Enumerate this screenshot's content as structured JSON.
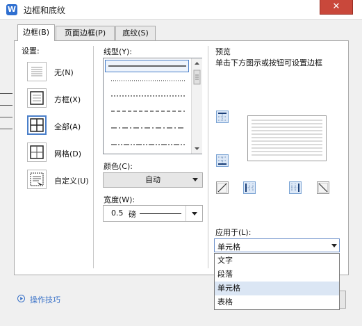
{
  "window": {
    "title": "边框和底纹",
    "app_icon": "W",
    "close": "✕"
  },
  "tabs": [
    {
      "label": "边框(B)"
    },
    {
      "label": "页面边框(P)"
    },
    {
      "label": "底纹(S)"
    }
  ],
  "settings": {
    "label": "设置:",
    "items": [
      {
        "label": "无(N)",
        "icon": "border-none-icon"
      },
      {
        "label": "方框(X)",
        "icon": "border-box-icon"
      },
      {
        "label": "全部(A)",
        "icon": "border-all-icon"
      },
      {
        "label": "网格(D)",
        "icon": "border-grid-icon"
      },
      {
        "label": "自定义(U)",
        "icon": "border-custom-icon"
      }
    ]
  },
  "line_style": {
    "label": "线型(Y):"
  },
  "color": {
    "label": "颜色(C):",
    "value": "自动"
  },
  "width": {
    "label": "宽度(W):",
    "value": "0.5",
    "unit": "磅"
  },
  "preview": {
    "label": "预览",
    "hint": "单击下方图示或按钮可设置边框"
  },
  "apply_to": {
    "label": "应用于(L):",
    "value": "单元格",
    "options": [
      "文字",
      "段落",
      "单元格",
      "表格"
    ],
    "highlighted": "单元格"
  },
  "tips": {
    "label": "操作技巧"
  },
  "colors": {
    "accent": "#3a72c8",
    "close": "#c9483b",
    "highlight": "#dbe6f4"
  }
}
